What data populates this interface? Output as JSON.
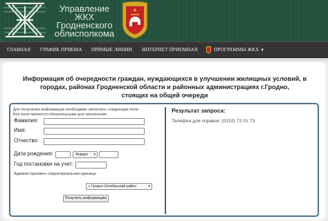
{
  "header": {
    "site_title": "Управление ЖКХ Гродненского облисполкома",
    "title_lines": [
      "Управление ЖКХ",
      "Гродненского",
      "облисполкома"
    ],
    "logo_icon": "zhkh-logo-icon",
    "coat_icon": "coat-of-arms-icon"
  },
  "nav": {
    "items": [
      {
        "label": "ГЛАВНАЯ"
      },
      {
        "label": "ГРАФИК ПРИЕМА"
      },
      {
        "label": "ПРЯМЫЕ ЛИНИИ"
      },
      {
        "label": "ИНТЕРНЕТ ПРИЕМНАЯ"
      },
      {
        "label": "ПРОГРАММЫ ЖКХ",
        "icon": "coat-of-arms-icon",
        "has_dropdown": true
      }
    ]
  },
  "main": {
    "title": "Информация об очередности граждан, нуждающихся в улучшении жилищных условий, в городах, районах Гродненской области и районных администрациях г.Гродно, стоящих на общей очереди",
    "title_lines": [
      "Информация об очередности граждан, нуждающихся в улучшении жилищных условий, в",
      "городах, районах Гродненской области и районных администрациях г.Гродно,",
      "стоящих на общей очереди"
    ],
    "form": {
      "help_line1": "Для получения информации необходимо заполнить следующие поля.",
      "help_line2": "Все поля являются обязательными для заполнения.",
      "surname_label": "Фамилия:",
      "surname_value": "",
      "name_label": "Имя:",
      "name_value": "",
      "patronymic_label": "Отчество:",
      "patronymic_value": "",
      "birth_label": "Дата рождения:",
      "birth_day": "",
      "birth_month": "Января",
      "birth_year": "",
      "queue_year_label": "Год постановки на учет:",
      "queue_year_value": "",
      "admin_unit_label": "Административно–территориальная единица:",
      "admin_unit_value": "г. Гродно Октябрьский район",
      "submit_label": "Получить информацию"
    },
    "result": {
      "title": "Результат запроса:",
      "phone_text": "Телефон для справок: (0152) 72 01 73"
    }
  }
}
